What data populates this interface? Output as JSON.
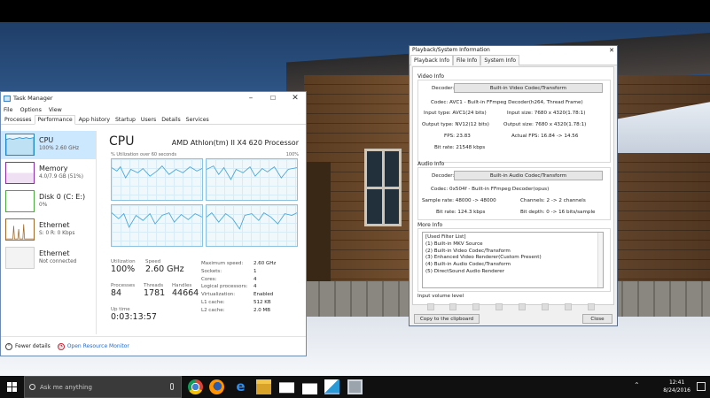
{
  "task_manager": {
    "title": "Task Manager",
    "menu": [
      "File",
      "Options",
      "View"
    ],
    "tabs": [
      "Processes",
      "Performance",
      "App history",
      "Startup",
      "Users",
      "Details",
      "Services"
    ],
    "sidebar": [
      {
        "name": "CPU",
        "sub": "100% 2.60 GHz",
        "color": "#1e88c7"
      },
      {
        "name": "Memory",
        "sub": "4.0/7.9 GB (51%)",
        "color": "#8b2fa8"
      },
      {
        "name": "Disk 0 (C: E:)",
        "sub": "0%",
        "color": "#4aa83e"
      },
      {
        "name": "Ethernet",
        "sub": "S: 0 R: 0 Kbps",
        "color": "#a06a2b"
      },
      {
        "name": "Ethernet",
        "sub": "Not connected",
        "color": "#a0a0a0"
      }
    ],
    "main": {
      "title": "CPU",
      "processor": "AMD Athlon(tm) II X4 620 Processor",
      "util_label": "% Utilization over 60 seconds",
      "util_max": "100%"
    },
    "stats": {
      "utilization": {
        "label": "Utilization",
        "value": "100%"
      },
      "speed": {
        "label": "Speed",
        "value": "2.60 GHz"
      },
      "processes": {
        "label": "Processes",
        "value": "84"
      },
      "threads": {
        "label": "Threads",
        "value": "1781"
      },
      "handles": {
        "label": "Handles",
        "value": "44664"
      },
      "uptime": {
        "label": "Up time",
        "value": "0:03:13:57"
      }
    },
    "specs": [
      {
        "label": "Maximum speed:",
        "value": "2.60 GHz"
      },
      {
        "label": "Sockets:",
        "value": "1"
      },
      {
        "label": "Cores:",
        "value": "4"
      },
      {
        "label": "Logical processors:",
        "value": "4"
      },
      {
        "label": "Virtualization:",
        "value": "Enabled"
      },
      {
        "label": "L1 cache:",
        "value": "512 KB"
      },
      {
        "label": "L2 cache:",
        "value": "2.0 MB"
      }
    ],
    "footer": {
      "fewer": "Fewer details",
      "monitor": "Open Resource Monitor"
    }
  },
  "playback": {
    "title": "Playback/System Information",
    "tabs": [
      "Playback Info",
      "File Info",
      "System Info"
    ],
    "video": {
      "section": "Video Info",
      "decoder_label": "Decoder:",
      "decoder_btn": "Built-in Video Codec/Transform",
      "codec": "Codec: AVC1 - Built-in FFmpeg Decoder(h264, Thread Frame)",
      "input_type": "Input type: AVC1(24 bits)",
      "input_size": "Input size: 7680 x 4320(1.78:1)",
      "output_type": "Output type: NV12(12 bits)",
      "output_size": "Output size: 7680 x 4320(1.78:1)",
      "fps": "FPS: 23.83",
      "actual_fps": "Actual FPS: 16.84 -> 14.56",
      "bitrate": "Bit rate: 21548 kbps"
    },
    "audio": {
      "section": "Audio Info",
      "decoder_label": "Decoder:",
      "decoder_btn": "Built-in Audio Codec/Transform",
      "codec": "Codec: 0x504f - Built-in FFmpeg Decoder(opus)",
      "sample_rate": "Sample rate: 48000 -> 48000",
      "channels": "Channels: 2 -> 2 channels",
      "bitrate": "Bit rate: 124.3 kbps",
      "bitdepth": "Bit depth: 0 -> 16 bits/sample"
    },
    "more": {
      "section": "More Info",
      "items": [
        "[Used Filter List]",
        "(1) Built-in MKV Source",
        "(2) Built-in Video Codec/Transform",
        "(3) Enhanced Video Renderer(Custom Present)",
        "(4) Built-in Audio Codec/Transform",
        "(5) DirectSound Audio Renderer"
      ]
    },
    "volume_label": "Input volume level",
    "copy_btn": "Copy to the clipboard",
    "close_btn": "Close"
  },
  "taskbar": {
    "search_placeholder": "Ask me anything",
    "time": "12:41",
    "date": "8/24/2016"
  }
}
